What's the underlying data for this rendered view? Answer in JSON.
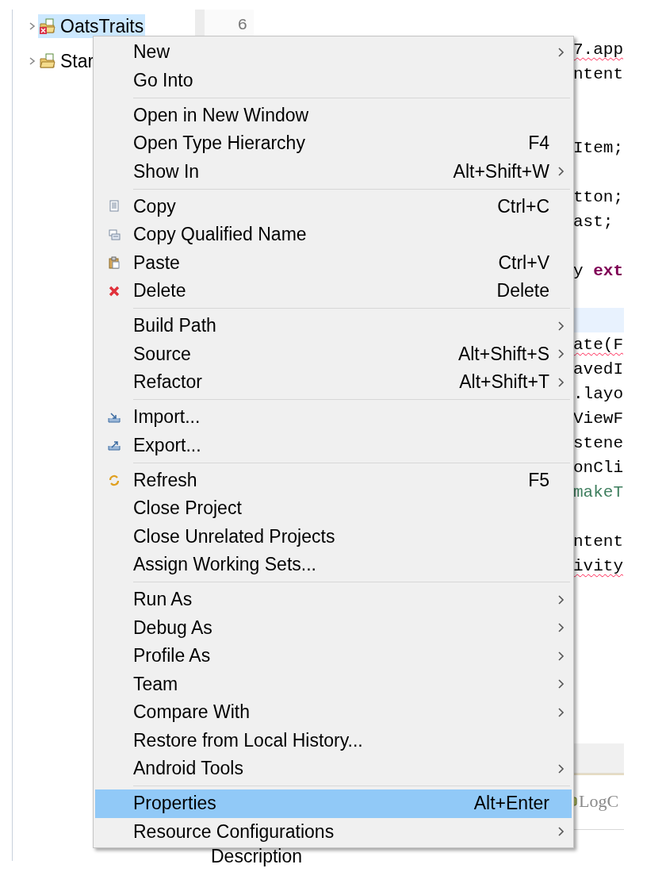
{
  "tree": {
    "items": [
      {
        "label": "OatsTraits",
        "selected": true,
        "expanded": false,
        "error": true
      },
      {
        "label": "Star",
        "selected": false,
        "expanded": false,
        "error": false
      }
    ]
  },
  "editor": {
    "line_number": "6",
    "lines": [
      {
        "kind": "blank"
      },
      {
        "kind": "code",
        "text": "7.app",
        "error": true
      },
      {
        "kind": "code",
        "text": "ntent"
      },
      {
        "kind": "blank"
      },
      {
        "kind": "blank"
      },
      {
        "kind": "code",
        "text": "Item;"
      },
      {
        "kind": "blank"
      },
      {
        "kind": "code",
        "text": "tton;"
      },
      {
        "kind": "code",
        "text": "ast;"
      },
      {
        "kind": "blank"
      },
      {
        "kind": "code",
        "text": "y **ext**"
      },
      {
        "kind": "blank"
      },
      {
        "kind": "current"
      },
      {
        "kind": "code",
        "text": "ate(F",
        "error": true
      },
      {
        "kind": "code",
        "text": "avedI"
      },
      {
        "kind": "code",
        "text": ".layo"
      },
      {
        "kind": "code",
        "text": "ViewF"
      },
      {
        "kind": "code",
        "text": "stene"
      },
      {
        "kind": "code",
        "text": "onCli"
      },
      {
        "kind": "comment",
        "text": "makeT"
      },
      {
        "kind": "blank"
      },
      {
        "kind": "code",
        "text": "ntent"
      },
      {
        "kind": "code",
        "text": "ivity",
        "error": true
      }
    ]
  },
  "bottom_panel": {
    "tab": "LogC",
    "column": "Description"
  },
  "context_menu": {
    "groups": [
      {
        "items": [
          {
            "label": "New",
            "submenu": true,
            "selected": false
          },
          {
            "label": "Go Into",
            "submenu": false,
            "selected": false
          }
        ]
      },
      {
        "items": [
          {
            "label": "Open in New Window",
            "submenu": false,
            "selected": false
          },
          {
            "label": "Open Type Hierarchy",
            "shortcut": "F4",
            "submenu": false,
            "selected": false
          },
          {
            "label": "Show In",
            "shortcut": "Alt+Shift+W",
            "submenu": true,
            "selected": false
          }
        ]
      },
      {
        "items": [
          {
            "label": "Copy",
            "shortcut": "Ctrl+C",
            "kind": "copy",
            "submenu": false,
            "selected": false
          },
          {
            "label": "Copy Qualified Name",
            "kind": "copyname",
            "submenu": false,
            "selected": false
          },
          {
            "label": "Paste",
            "shortcut": "Ctrl+V",
            "kind": "paste",
            "submenu": false,
            "selected": false
          },
          {
            "label": "Delete",
            "shortcut": "Delete",
            "kind": "delete",
            "submenu": false,
            "selected": false
          }
        ]
      },
      {
        "items": [
          {
            "label": "Build Path",
            "submenu": true,
            "selected": false
          },
          {
            "label": "Source",
            "shortcut": "Alt+Shift+S",
            "submenu": true,
            "selected": false
          },
          {
            "label": "Refactor",
            "shortcut": "Alt+Shift+T",
            "submenu": true,
            "selected": false
          }
        ]
      },
      {
        "items": [
          {
            "label": "Import...",
            "kind": "import",
            "submenu": false,
            "selected": false
          },
          {
            "label": "Export...",
            "kind": "export",
            "submenu": false,
            "selected": false
          }
        ]
      },
      {
        "items": [
          {
            "label": "Refresh",
            "shortcut": "F5",
            "kind": "refresh",
            "submenu": false,
            "selected": false
          },
          {
            "label": "Close Project",
            "submenu": false,
            "selected": false
          },
          {
            "label": "Close Unrelated Projects",
            "submenu": false,
            "selected": false
          },
          {
            "label": "Assign Working Sets...",
            "submenu": false,
            "selected": false
          }
        ]
      },
      {
        "items": [
          {
            "label": "Run As",
            "submenu": true,
            "selected": false
          },
          {
            "label": "Debug As",
            "submenu": true,
            "selected": false
          },
          {
            "label": "Profile As",
            "submenu": true,
            "selected": false
          },
          {
            "label": "Team",
            "submenu": true,
            "selected": false
          },
          {
            "label": "Compare With",
            "submenu": true,
            "selected": false
          },
          {
            "label": "Restore from Local History...",
            "submenu": false,
            "selected": false
          },
          {
            "label": "Android Tools",
            "submenu": true,
            "selected": false
          }
        ]
      },
      {
        "items": [
          {
            "label": "Properties",
            "shortcut": "Alt+Enter",
            "submenu": false,
            "selected": true
          },
          {
            "label": "Resource Configurations",
            "submenu": true,
            "selected": false
          }
        ]
      }
    ]
  }
}
